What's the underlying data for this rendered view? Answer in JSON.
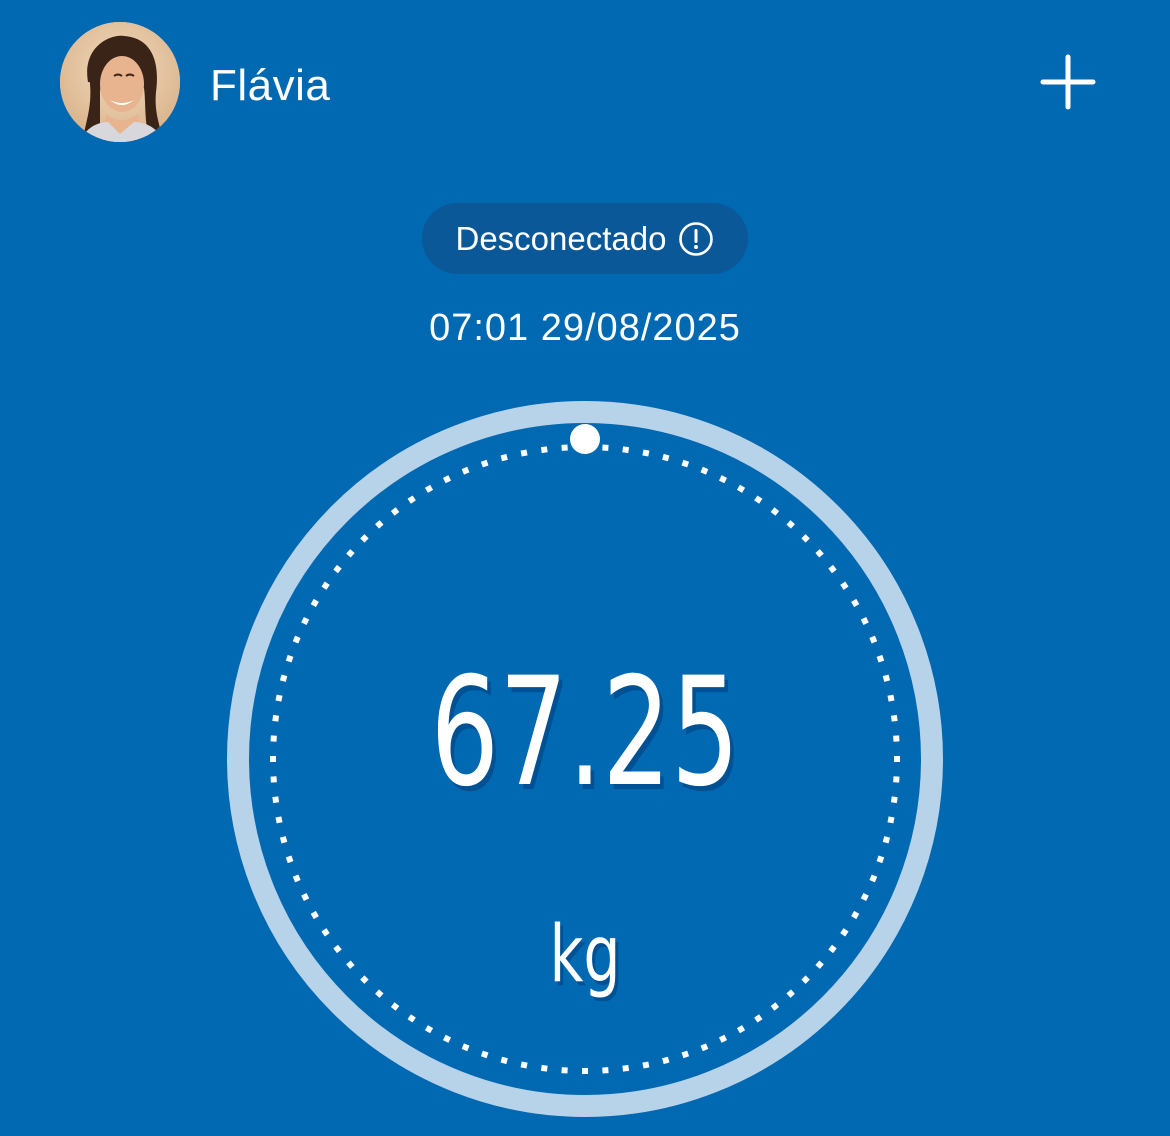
{
  "header": {
    "user_name": "Flávia",
    "avatar_icon": "user-photo",
    "add_icon": "plus-icon"
  },
  "status": {
    "label": "Desconectado",
    "icon": "alert-circle-icon"
  },
  "measurement": {
    "timestamp": "07:01 29/08/2025",
    "value": "67.25",
    "unit": "kg"
  },
  "colors": {
    "background": "#0168B2",
    "pill_background": "#0A5898",
    "ring": "#B7D3EA",
    "text": "#FFFFFF"
  }
}
